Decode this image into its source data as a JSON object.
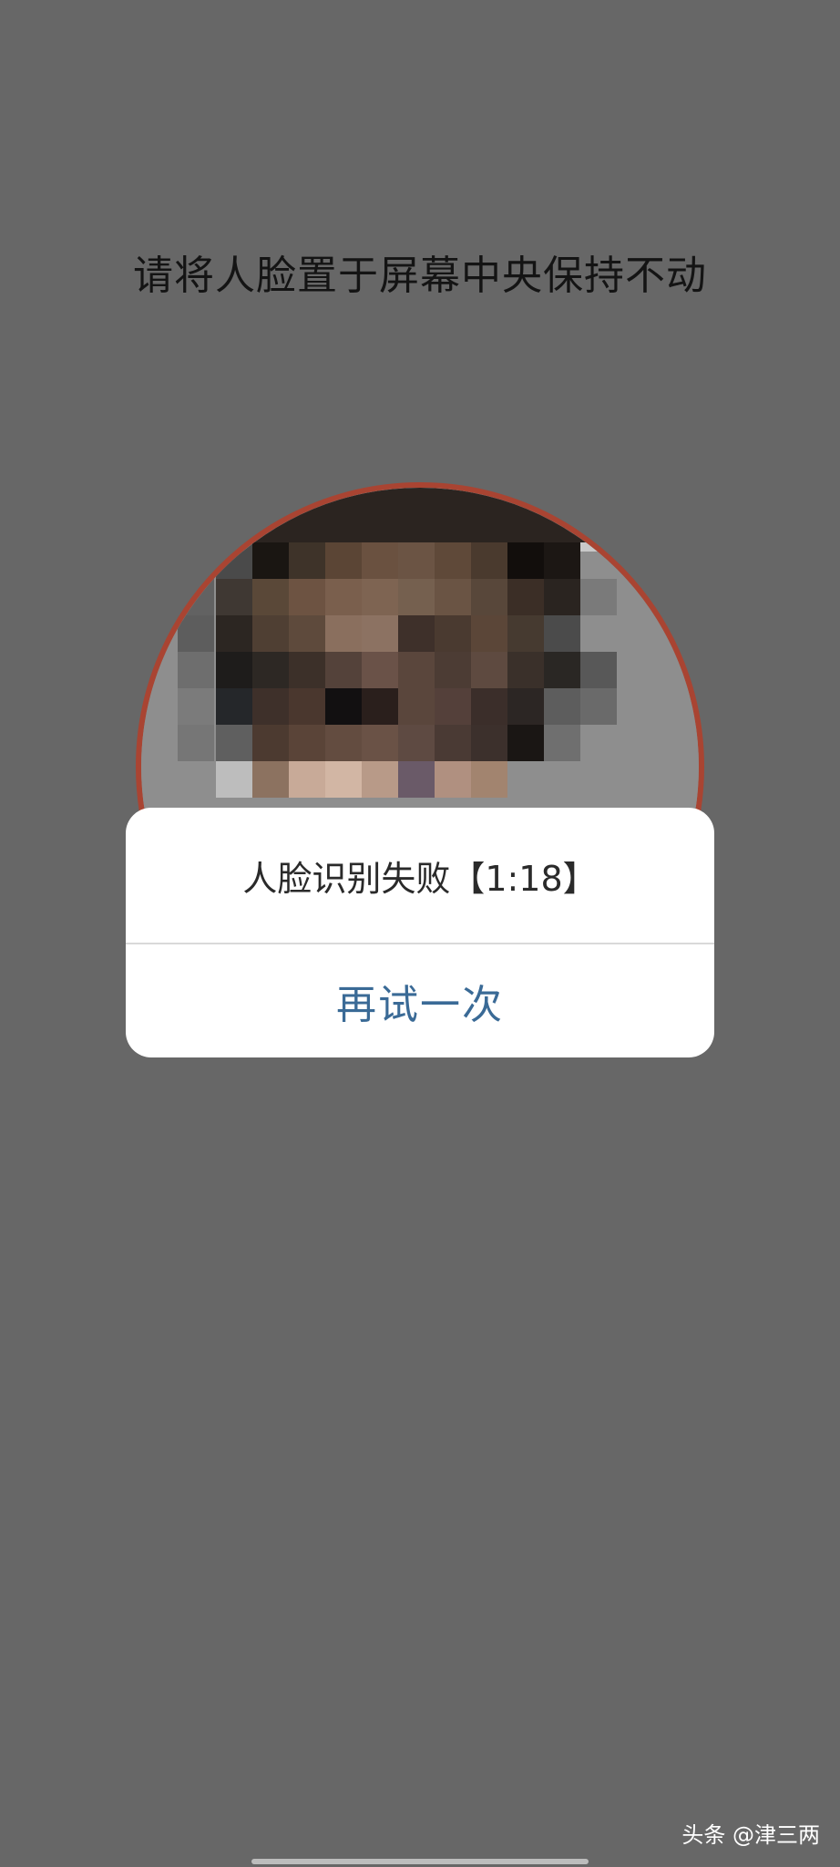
{
  "screen": {
    "instruction": "请将人脸置于屏幕中央保持不动",
    "face_preview": "pixelated-camera-face"
  },
  "dialog": {
    "message": "人脸识别失败【1:18】",
    "retry_label": "再试一次"
  },
  "watermark": {
    "text": "头条 @津三两"
  },
  "colors": {
    "background": "#676767",
    "ring": "#a94432",
    "button_text": "#3a6a96"
  }
}
